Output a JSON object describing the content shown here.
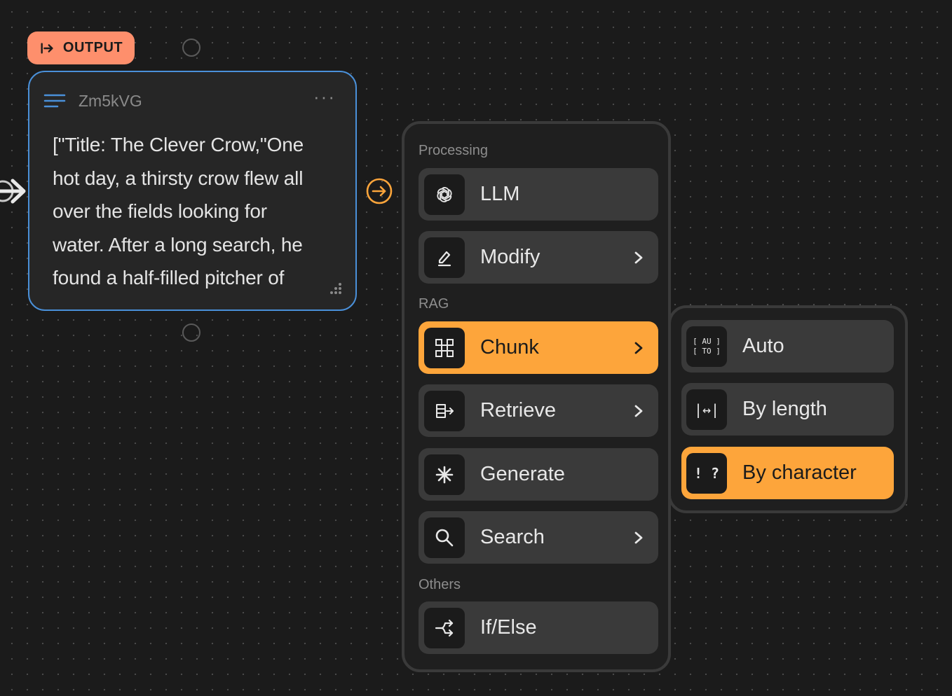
{
  "canvas": {
    "output_badge": {
      "label": "OUTPUT",
      "icon": "output-arrow-icon",
      "color": "#fe8f6c"
    },
    "text_node": {
      "id": "Zm5kVG",
      "content": "[\"Title: The Clever Crow,\"One\nhot day, a thirsty crow flew all\nover the fields looking for\nwater. After a long search, he\nfound a half-filled pitcher of",
      "border_color": "#4a90d9"
    }
  },
  "menu": {
    "sections": [
      {
        "label": "Processing"
      },
      {
        "label": "RAG"
      },
      {
        "label": "Others"
      }
    ],
    "items": [
      {
        "label": "LLM",
        "icon": "openai-icon",
        "submenu": false
      },
      {
        "label": "Modify",
        "icon": "edit-icon",
        "submenu": true
      },
      {
        "label": "Chunk",
        "icon": "grid-icon",
        "submenu": true,
        "active": true
      },
      {
        "label": "Retrieve",
        "icon": "retrieve-icon",
        "submenu": true
      },
      {
        "label": "Generate",
        "icon": "asterisk-icon",
        "submenu": false
      },
      {
        "label": "Search",
        "icon": "search-icon",
        "submenu": true
      },
      {
        "label": "If/Else",
        "icon": "branch-icon",
        "submenu": false
      }
    ],
    "accent": "#fda53b"
  },
  "submenu": {
    "items": [
      {
        "label": "Auto",
        "icon": "auto-icon",
        "icon_text_1": "[ AU ]",
        "icon_text_2": "[ TO ]"
      },
      {
        "label": "By length",
        "icon": "length-icon",
        "icon_text": "|↔|"
      },
      {
        "label": "By character",
        "icon": "character-icon",
        "icon_text": "! ?",
        "active": true
      }
    ]
  }
}
